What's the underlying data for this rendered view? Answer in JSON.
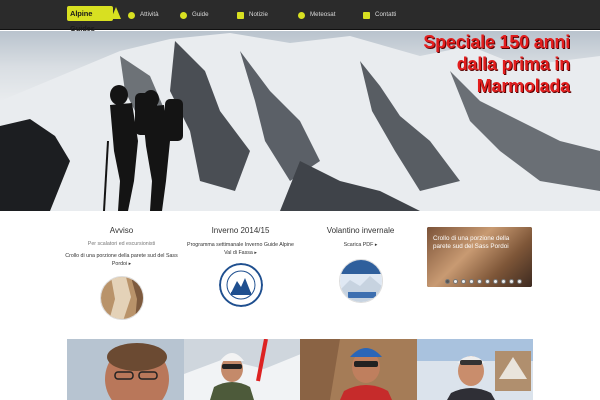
{
  "brand": {
    "logo_text": "Alpine Guides"
  },
  "nav": [
    {
      "label": "Attività",
      "icon": "activity-icon"
    },
    {
      "label": "Guide",
      "icon": "guide-icon"
    },
    {
      "label": "Notizie",
      "icon": "news-icon"
    },
    {
      "label": "Meteosat",
      "icon": "globe-icon"
    },
    {
      "label": "Contatti",
      "icon": "mail-icon"
    }
  ],
  "hero": {
    "caption_lines": [
      "Speciale 150 anni",
      "dalla prima in",
      "Marmolada"
    ]
  },
  "columns": [
    {
      "title": "Avviso",
      "subtitle": "Per scalatori ed escursionisti",
      "link": "Crollo di una porzione della parete sud del Sass Pordoi"
    },
    {
      "title": "Inverno 2014/15",
      "subtitle": "",
      "link": "Programma settimanale Inverno Guide Alpine Val di Fassa"
    },
    {
      "title": "Volantino invernale",
      "subtitle": "",
      "link": "Scarica PDF"
    }
  ],
  "slider": {
    "text": "Crollo di una porzione della parete sud del Sass Pordoi",
    "dot_count": 10,
    "active_dot": 0
  },
  "guides": [
    {
      "icon": "guide-portrait-1"
    },
    {
      "icon": "guide-portrait-2"
    },
    {
      "icon": "guide-portrait-3"
    },
    {
      "icon": "guide-portrait-4"
    }
  ],
  "colors": {
    "accent": "#d8e021",
    "nav_bg": "#2b2b2b",
    "caption": "#e31e1e"
  }
}
